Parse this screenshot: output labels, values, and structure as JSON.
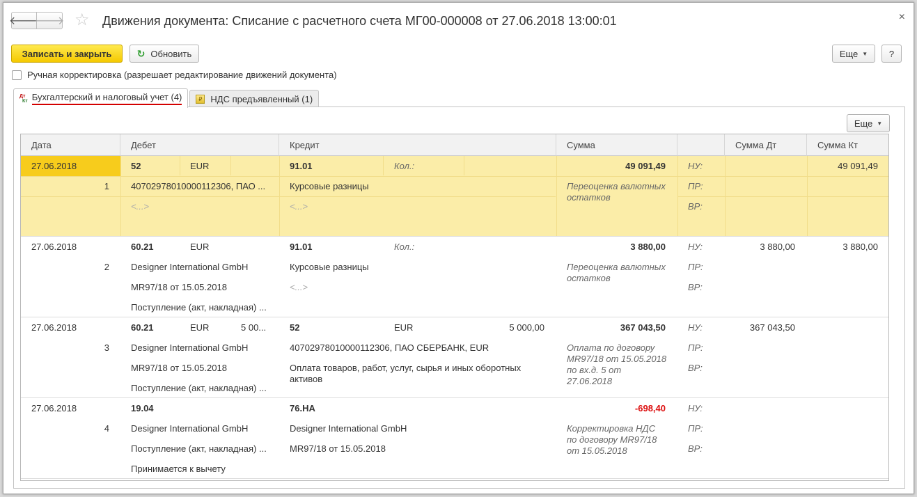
{
  "window": {
    "title": "Движения документа: Списание с расчетного счета МГ00-000008 от 27.06.2018 13:00:01",
    "close": "×",
    "back": "🡐",
    "forward": "🡒",
    "star": "☆"
  },
  "toolbar": {
    "save_close": "Записать и закрыть",
    "refresh": "Обновить",
    "more": "Еще",
    "help": "?"
  },
  "manual_correction": "Ручная корректировка (разрешает редактирование движений документа)",
  "tabs": [
    {
      "label": "Бухгалтерский и налоговый учет (4)",
      "icon": "dt-kt-icon",
      "icon_dt": "Дт",
      "icon_kt": "Кт"
    },
    {
      "label": "НДС предъявленный (1)",
      "icon": "vat-icon"
    }
  ],
  "table": {
    "more": "Еще",
    "headers": {
      "date": "Дата",
      "debit": "Дебет",
      "credit": "Кредит",
      "sum": "Сумма",
      "blank": "",
      "sum_dt": "Сумма Дт",
      "sum_kt": "Сумма Кт"
    },
    "labels": {
      "qty": "Кол.:",
      "nu": "НУ:",
      "pr": "ПР:",
      "vr": "ВР:"
    },
    "rows": [
      {
        "date": "27.06.2018",
        "num": "1",
        "debit_account": "52",
        "debit_currency": "EUR",
        "debit_amount": "",
        "debit_sub1": "40702978010000112306, ПАО ...",
        "debit_sub2": "<...>",
        "debit_sub3": "",
        "credit_account": "91.01",
        "credit_currency": "",
        "credit_amount": "",
        "credit_sub1": "Курсовые разницы",
        "credit_sub2": "<...>",
        "sum": "49 091,49",
        "comment": "Переоценка валютных остатков",
        "sum_dt": "",
        "sum_kt": "49 091,49"
      },
      {
        "date": "27.06.2018",
        "num": "2",
        "debit_account": "60.21",
        "debit_currency": "EUR",
        "debit_amount": "",
        "debit_sub1": "Designer International GmbH",
        "debit_sub2": "MR97/18 от 15.05.2018",
        "debit_sub3": "Поступление (акт, накладная) ...",
        "credit_account": "91.01",
        "credit_currency": "",
        "credit_amount": "",
        "credit_sub1": "Курсовые разницы",
        "credit_sub2": "<...>",
        "sum": "3 880,00",
        "comment": "Переоценка валютных остатков",
        "sum_dt": "3 880,00",
        "sum_kt": "3 880,00"
      },
      {
        "date": "27.06.2018",
        "num": "3",
        "debit_account": "60.21",
        "debit_currency": "EUR",
        "debit_amount": "5 00...",
        "debit_sub1": "Designer International GmbH",
        "debit_sub2": "MR97/18 от 15.05.2018",
        "debit_sub3": "Поступление (акт, накладная) ...",
        "credit_account": "52",
        "credit_currency": "EUR",
        "credit_amount": "5 000,00",
        "credit_sub1": "40702978010000112306, ПАО СБЕРБАНК, EUR",
        "credit_sub2": "Оплата товаров, работ, услуг, сырья и иных оборотных активов",
        "sum": "367 043,50",
        "comment": "Оплата по договору MR97/18 от 15.05.2018 по вх.д. 5 от 27.06.2018",
        "sum_dt": "367 043,50",
        "sum_kt": ""
      },
      {
        "date": "27.06.2018",
        "num": "4",
        "debit_account": "19.04",
        "debit_currency": "",
        "debit_amount": "",
        "debit_sub1": "Designer International GmbH",
        "debit_sub2": "Поступление (акт, накладная) ...",
        "debit_sub3": "Принимается к вычету",
        "credit_account": "76.НА",
        "credit_currency": "",
        "credit_amount": "",
        "credit_sub1": "Designer International GmbH",
        "credit_sub2": "MR97/18 от 15.05.2018",
        "sum": "-698,40",
        "comment": "Корректировка НДС по договору MR97/18 от 15.05.2018",
        "sum_dt": "",
        "sum_kt": ""
      }
    ]
  },
  "colors": {
    "accent": "#f5c900",
    "selected_row": "#fbeda8",
    "negative": "#d11111",
    "tab_underline": "#d30000"
  }
}
